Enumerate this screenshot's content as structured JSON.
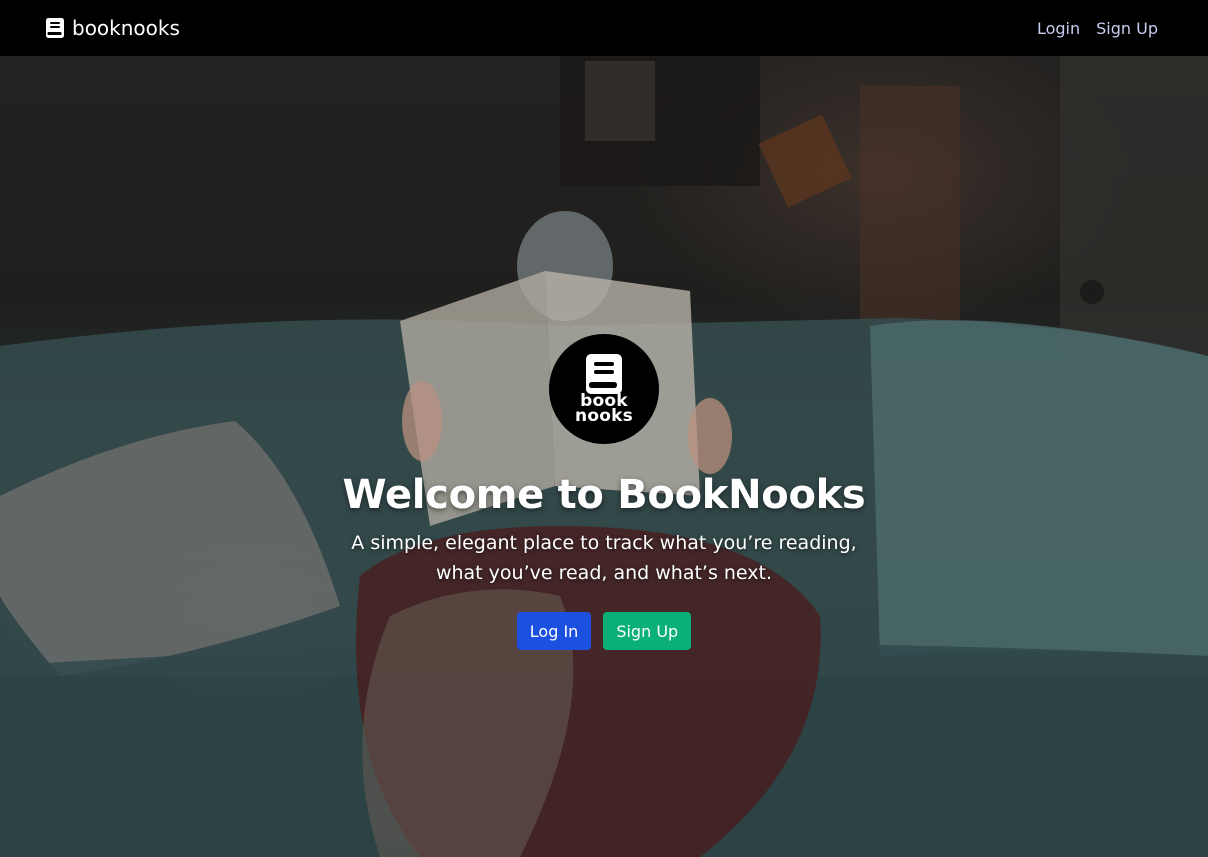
{
  "navbar": {
    "brand": "booknooks",
    "links": [
      "Login",
      "Sign Up"
    ]
  },
  "hero": {
    "logo_lines": [
      "book",
      "nooks"
    ],
    "title": "Welcome to BookNooks",
    "subtitle_line1": "A simple, elegant place to track what you’re reading,",
    "subtitle_line2": "what you’ve read, and what’s next.",
    "login_button": "Log In",
    "signup_button": "Sign Up"
  },
  "colors": {
    "navbar_bg": "#000000",
    "login_button": "#1c50e0",
    "signup_button": "#0bb079",
    "nav_link": "#c7cdf0"
  },
  "icons": {
    "brand": "book-icon",
    "logo": "book-icon"
  }
}
